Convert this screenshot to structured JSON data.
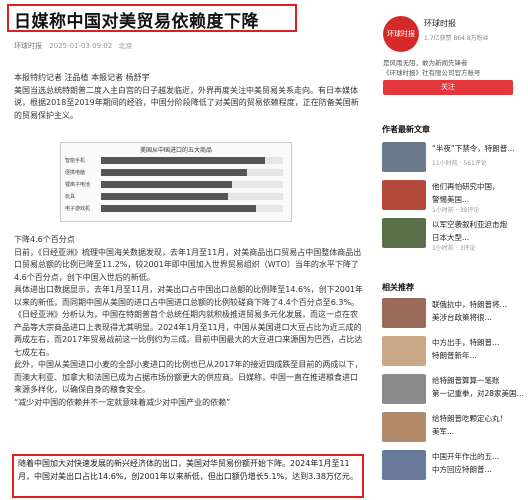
{
  "article": {
    "headline": "日媒称中国对美贸易依赖度下降",
    "source": "环球时报",
    "date": "2025-01-03 09:02",
    "location": "北京",
    "paragraphs": [
      "本报特约记者 汪品植 本报记者 杨舒宇",
      "美国当选总统特朗普二度入主白宫的日子越发临近，外界再度关注中美贸易关系走向。有日本媒体说，根据2018至2019年期间的经验，中国分阶段降低了对美国的贸易依赖程度，正在防备美国新的贸易保护主义。"
    ],
    "figure": {
      "title": "美国从中国进口的五大商品",
      "rows": [
        {
          "label": "智能手机",
          "value": 0.9
        },
        {
          "label": "便携电脑",
          "value": 0.8
        },
        {
          "label": "锂离子电池",
          "value": 0.72
        },
        {
          "label": "玩具",
          "value": 0.7
        },
        {
          "label": "电子游戏机",
          "value": 0.85
        }
      ]
    },
    "body": [
      "下降4.6个百分点",
      "日前，《日经亚洲》梳理中国海关数据发现，去年1月至11月，对美商品出口贸易占中国整体商品出口贸易总额的比例已降至11.2%，较2001年即中国加入世界贸易组织（WTO）当年的水平下降了4.6个百分点，创下中国入世后的新低。",
      "具体进出口数据显示，去年1月至11月，对美出口占中国出口总额的比例降至14.6%，创下2001年以来的新低，而同期中国从美国的进口占中国进口总额的比例较磋商下降了4.4个百分点至6.3%。",
      "《日经亚洲》分析认为，中国在特朗普首个总统任期内就积极推进贸易多元化发展，而这一点在农产品等大宗商品进口上表现得尤其明显。2024年1月至11月，中国从美国进口大豆占比为近三成的两成左右，而2017年贸易战前这一比例约为三成。目前中国最大的大豆进口来源国为巴西，占比达七成左右。",
      "此外，中国从美国进口小麦的全部小麦进口的比例也已从2017年的接近四成跌至目前的两成以下，而澳大利亚、加拿大和法国已成为占据市场份额更大的供应商。日媒称，中国一直在推进粮食进口来源多样化，以确保自身的粮食安全。",
      "“减少对中国的依赖并不一定就意味着减少对中国产业的依赖”"
    ],
    "highlight": "随着中国加大对快速发展的新兴经济体的出口，美国对华贸易份额开始下降。2024年1月至11月，中国对美出口占比14.6%，创2001年以来新低，但出口额仍增长5.1%，达到3.38万亿元。"
  },
  "account": {
    "avatar_text": "环球时报",
    "name": "环球时报",
    "followers": "1.7亿获赞",
    "fans": "864.8万粉丝",
    "desc1": "是风雨无阻，敢为新闻先锋者",
    "desc2": "《环球时报》社有限公司官方账号",
    "follow_label": "关注"
  },
  "latest": {
    "title": "作者最新文章",
    "items": [
      {
        "title": "“半夜”下禁令，特朗普…",
        "time": "11小时前",
        "comments": "561评论",
        "color": "#6b7b8c"
      },
      {
        "title": "他们再怕研究中国，",
        "sub": "警惕美国...",
        "time": "1小时前",
        "comments": "39评论",
        "color": "#b44a3a"
      },
      {
        "title": "以军空袭叙利亚迫击炮",
        "sub": "日本大型...",
        "time": "1小时前",
        "comments": "3评论",
        "color": "#5a6f4a"
      }
    ]
  },
  "related": {
    "title": "相关推荐",
    "items": [
      {
        "title": "联俄抗中，特朗普将…",
        "sub": "美涉台政策将很…",
        "time": "",
        "comments": "",
        "color": "#9a6a5a"
      },
      {
        "title": "中方出手，特朗普…",
        "sub": "特朗普新年…",
        "time": "",
        "comments": "",
        "color": "#c9a98a"
      },
      {
        "title": "给特朗普算算一笔账",
        "sub": "第一记重拳，对28家美国…",
        "time": "",
        "comments": "",
        "color": "#8c8c8c"
      },
      {
        "title": "给特朗普吃颗定心丸！",
        "sub": "美军...",
        "time": "",
        "comments": "",
        "color": "#b08a6a"
      },
      {
        "title": "中国开年作出的五…",
        "sub": "中方回应特朗普…",
        "time": "",
        "comments": "",
        "color": "#6a7a9a"
      }
    ]
  },
  "colors": {
    "accent": "#e02020",
    "follow": "#e3373d"
  }
}
